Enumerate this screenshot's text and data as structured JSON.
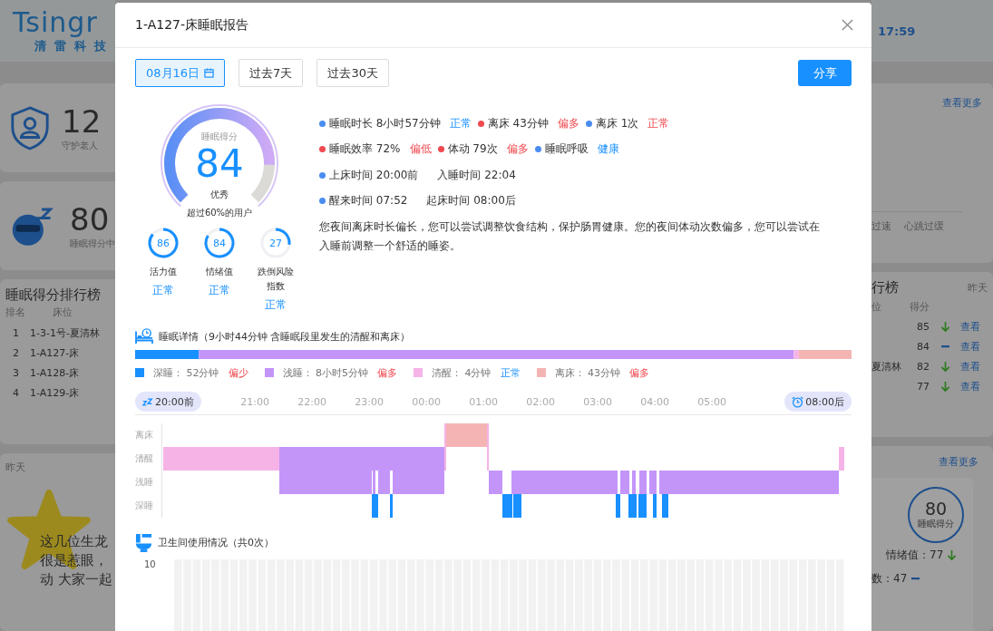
{
  "background": {
    "logo": {
      "wordmark": "Tsingr",
      "tagline": [
        "清",
        "雷",
        "科",
        "技"
      ]
    },
    "clock": "17:59",
    "stats": [
      {
        "kind": "guard",
        "value": "12",
        "label": "守护老人"
      },
      {
        "kind": "sleep",
        "value": "80",
        "label": "睡眠得分中"
      }
    ],
    "ranking_left": {
      "title": "睡眠得分排行榜",
      "columns": [
        "排名",
        "床位"
      ],
      "rows": [
        {
          "rank": "1",
          "bed": "1-3-1号-夏清林"
        },
        {
          "rank": "2",
          "bed": "1-A127-床"
        },
        {
          "rank": "3",
          "bed": "1-A128-床"
        },
        {
          "rank": "4",
          "bed": "1-A129-床"
        }
      ]
    },
    "praise": {
      "date": "昨天",
      "lines": [
        "这几位生龙",
        "很是惹眼，",
        "动 大家一起"
      ]
    },
    "alerts": {
      "more": "查看更多",
      "tabs": [
        "过速",
        "心跳过缓"
      ]
    },
    "ranking_right": {
      "title": "行榜",
      "period": "昨天",
      "columns": [
        "位",
        "得分"
      ],
      "rows": [
        {
          "score": "85",
          "falling": true,
          "action": "查看"
        },
        {
          "score": "84",
          "falling": false,
          "action": "查看"
        },
        {
          "bed": "夏清林",
          "score": "82",
          "falling": true,
          "action": "查看"
        },
        {
          "score": "77",
          "falling": true,
          "action": "查看"
        }
      ]
    },
    "featured": {
      "more": "查看更多",
      "score": "80",
      "score_label": "睡眠得分",
      "metrics": [
        {
          "label": "情绪值：77",
          "falling": true
        },
        {
          "label": "数：47",
          "falling": false
        }
      ]
    }
  },
  "dialog": {
    "title": "1-A127-床睡眠报告",
    "ranges": [
      {
        "kind": "date",
        "label": "08月16日",
        "selected": true
      },
      {
        "kind": "preset",
        "label": "过去7天",
        "selected": false
      },
      {
        "kind": "preset",
        "label": "过去30天",
        "selected": false
      }
    ],
    "share": "分享",
    "score": {
      "caption": "睡眠得分",
      "value": "84",
      "grade": "优秀",
      "rank_text": "超过60%的用户"
    },
    "indices": [
      {
        "value": "86",
        "label": "活力值",
        "status": "正常"
      },
      {
        "value": "84",
        "label": "情绪值",
        "status": "正常"
      },
      {
        "value": "27",
        "label": "跌倒风险指数",
        "status": "正常"
      }
    ],
    "facts": [
      [
        {
          "text": "睡眠时长 8小时57分钟",
          "color": "#4a8cf0",
          "verdict": {
            "text": "正常",
            "alert": false
          }
        },
        {
          "text": "离床 43分钟",
          "color": "#f0494f",
          "verdict": {
            "text": "偏多",
            "alert": true
          }
        },
        {
          "text": "离床 1次",
          "color": "#4a8cf0",
          "verdict": {
            "text": "正常",
            "alert": true
          }
        }
      ],
      [
        {
          "text": "睡眠效率 72%",
          "color": "#f0494f",
          "verdict": {
            "text": "偏低",
            "alert": true
          }
        },
        {
          "text": "体动 79次",
          "color": "#f0494f",
          "verdict": {
            "text": "偏多",
            "alert": true
          }
        },
        {
          "text": "睡眠呼吸",
          "color": "#4a8cf0",
          "verdict": {
            "text": "健康",
            "alert": false
          }
        }
      ],
      [
        {
          "text": "上床时间 20:00前",
          "color": "#4a8cf0"
        },
        {
          "text": "入睡时间 22:04"
        }
      ],
      [
        {
          "text": "醒来时间 07:52",
          "color": "#4a8cf0"
        },
        {
          "text": "起床时间 08:00后"
        }
      ]
    ],
    "advice": "您夜间离床时长偏长，您可以尝试调整饮食结构，保护肠胃健康。您的夜间体动次数偏多，您可以尝试在入睡前调整一个舒适的睡姿。",
    "detail": {
      "title": "睡眠详情",
      "note": "（9小时44分钟 含睡眠段里发生的清醒和离床）",
      "stages": [
        {
          "label": "深睡：",
          "value": "52分钟",
          "color": "#1890ff",
          "verdict": {
            "text": "偏少",
            "alert": true
          }
        },
        {
          "label": "浅睡：",
          "value": "8小时5分钟",
          "color": "#c395f9",
          "verdict": {
            "text": "偏多",
            "alert": true
          }
        },
        {
          "label": "清醒：",
          "value": "4分钟",
          "color": "#f5b3e6",
          "verdict": {
            "text": "正常",
            "alert": false
          }
        },
        {
          "label": "离床：",
          "value": "43分钟",
          "color": "#f5b4b4",
          "verdict": {
            "text": "偏多",
            "alert": true
          }
        }
      ],
      "axis_labels": [
        "离床",
        "清醒",
        "浅睡",
        "深睡"
      ],
      "timeline": {
        "start": "20:00前",
        "ticks": [
          "21:00",
          "22:00",
          "23:00",
          "00:00",
          "01:00",
          "02:00",
          "03:00",
          "04:00",
          "05:00"
        ],
        "end": "08:00后"
      }
    },
    "toilet": {
      "title": "卫生间使用情况",
      "note": "（共0次）",
      "y_tick": "10"
    }
  }
}
